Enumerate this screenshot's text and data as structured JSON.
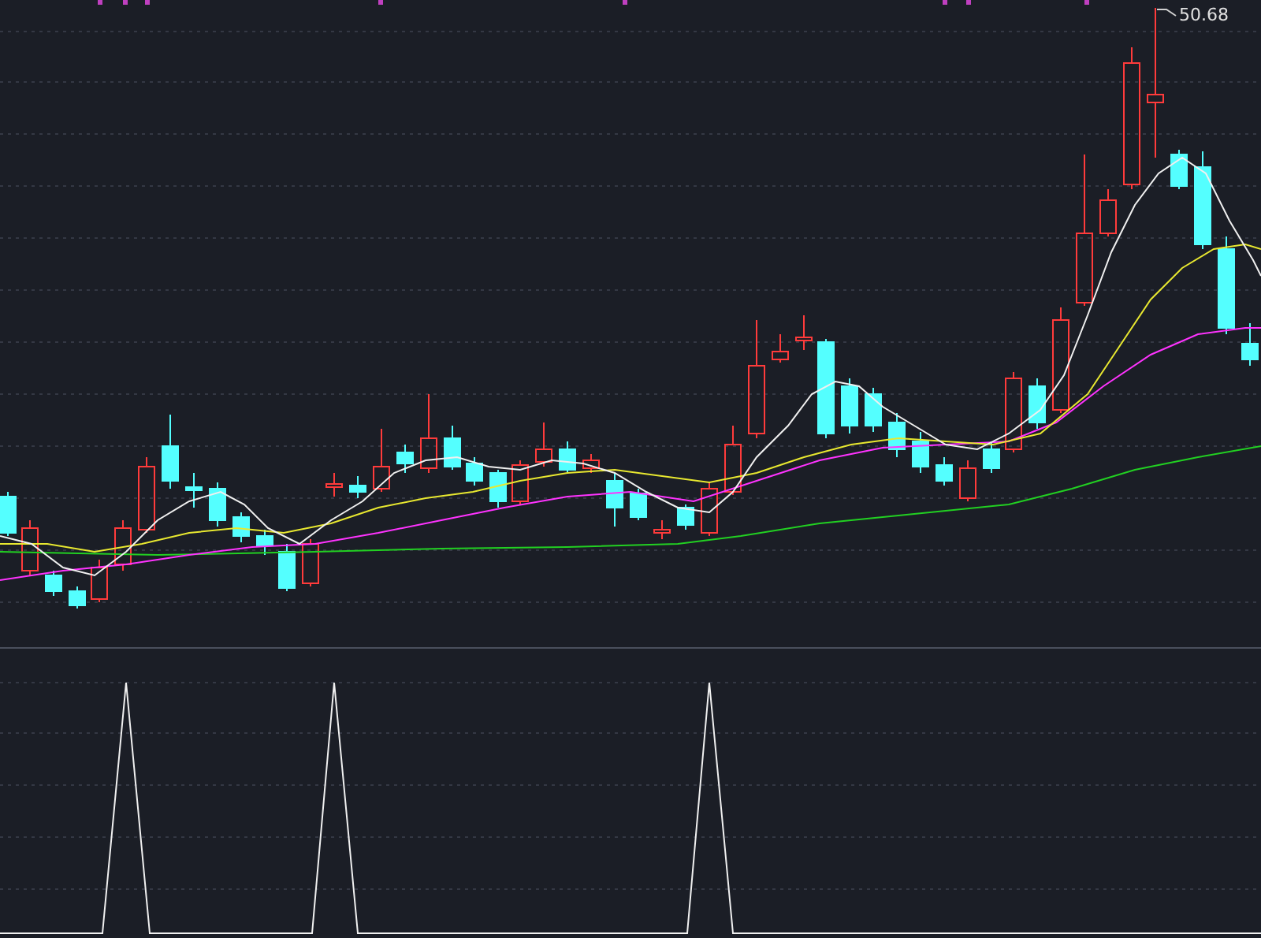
{
  "price_panel": {
    "high_label": "50.68"
  }
}
